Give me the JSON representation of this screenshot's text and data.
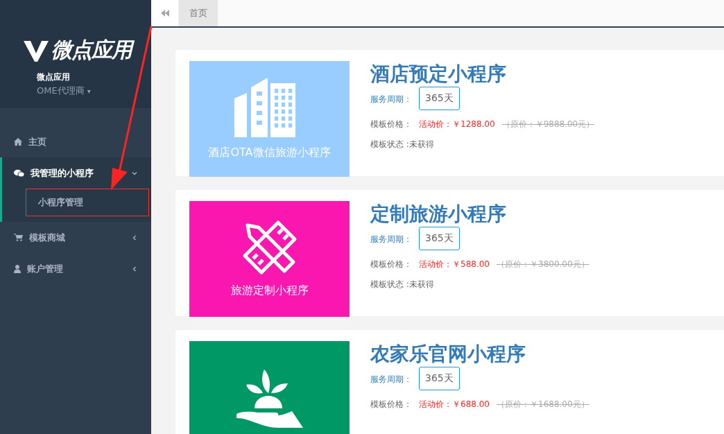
{
  "sidebar": {
    "logo": "微点应用",
    "app_name": "微点应用",
    "role": "OME代理商",
    "role_caret": "▾",
    "items": [
      {
        "label": "主页"
      },
      {
        "label": "我管理的小程序",
        "expanded": true,
        "children": [
          {
            "label": "小程序管理",
            "highlighted": true
          }
        ]
      },
      {
        "label": "模板商城",
        "expanded": false
      },
      {
        "label": "账户管理",
        "expanded": false
      }
    ]
  },
  "tabs": [
    {
      "label": "首页",
      "selected": true
    }
  ],
  "cards": [
    {
      "title": "酒店预定小程序",
      "image_text": "酒店OTA微信旅游小程序",
      "color": "#99ccff",
      "period_label": "服务周期：",
      "period": "365天",
      "price_label": "模板价格：",
      "sale_price": "活动价：￥1288.00",
      "original_price": "（原价：￥9888.00元）",
      "status": "模板状态 :未获得"
    },
    {
      "title": "定制旅游小程序",
      "image_text": "旅游定制小程序",
      "color": "#fa17b0",
      "period_label": "服务周期：",
      "period": "365天",
      "price_label": "模板价格：",
      "sale_price": "活动价：￥588.00",
      "original_price": "（原价：￥3800.00元）",
      "status": "模板状态 :未获得"
    },
    {
      "title": "农家乐官网小程序",
      "color": "#009966",
      "period_label": "服务周期：",
      "period": "365天",
      "price_label": "模板价格：",
      "sale_price": "活动价：￥688.00",
      "original_price": "（原价：￥1688.00元）"
    }
  ]
}
